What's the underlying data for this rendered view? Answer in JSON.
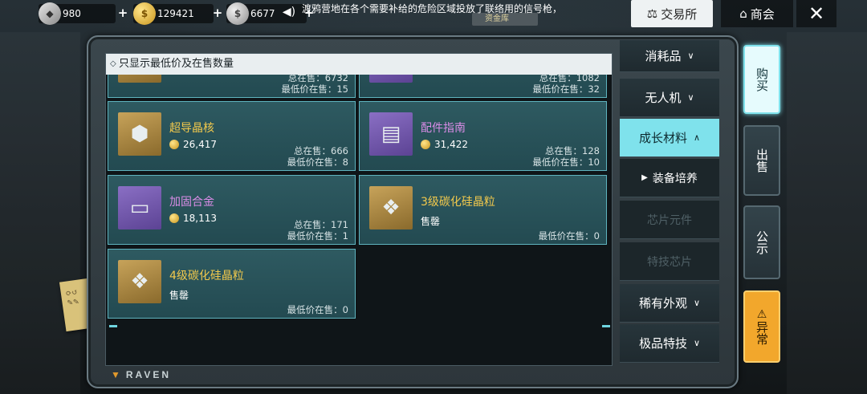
{
  "currencies": [
    {
      "name": "diamond",
      "icon": "diamond-icon",
      "value": "980"
    },
    {
      "name": "gold-coin",
      "icon": "gold-coin-icon",
      "value": "129421"
    },
    {
      "name": "silver-coin",
      "icon": "silver-coin-icon",
      "value": "6677"
    }
  ],
  "marquee": "渡鸦营地在各个需要补给的危险区域投放了联络用的信号枪，",
  "vault_chip": "资金库",
  "nav": {
    "exchange_label": "交易所",
    "guild_label": "商会"
  },
  "filter_label": "只显示最低价及在售数量",
  "partial_cards": [
    {
      "on_sale": "总在售：6732",
      "lowest_on_sale": "最低价在售：15"
    },
    {
      "on_sale": "总在售：1082",
      "lowest_on_sale": "最低价在售：32"
    }
  ],
  "items": [
    {
      "name": "超导晶核",
      "color": "gold",
      "icon": "crystal-core-icon",
      "price": "26,417",
      "on_sale": "总在售：666",
      "lowest_on_sale": "最低价在售：8"
    },
    {
      "name": "配件指南",
      "color": "purple",
      "icon": "guide-book-icon",
      "price": "31,422",
      "on_sale": "总在售：128",
      "lowest_on_sale": "最低价在售：10"
    },
    {
      "name": "加固合金",
      "color": "purple",
      "icon": "alloy-plate-icon",
      "price": "18,113",
      "on_sale": "总在售：171",
      "lowest_on_sale": "最低价在售：1"
    },
    {
      "name": "3级碳化硅晶粒",
      "color": "gold",
      "icon": "silicon-grain-icon",
      "sold_out": "售罄",
      "lowest_on_sale": "最低价在售：0"
    },
    {
      "name": "4级碳化硅晶粒",
      "color": "gold",
      "icon": "silicon-grain-icon",
      "sold_out": "售罄",
      "lowest_on_sale": "最低价在售：0"
    }
  ],
  "categories": [
    {
      "label": "消耗品",
      "state": "collapsed"
    },
    {
      "label": "无人机",
      "state": "collapsed"
    },
    {
      "label": "成长材料",
      "state": "expanded"
    },
    {
      "label": "装备培养",
      "state": "selected-sub"
    },
    {
      "label": "芯片元件",
      "state": "disabled-sub"
    },
    {
      "label": "特技芯片",
      "state": "disabled-sub"
    },
    {
      "label": "稀有外观",
      "state": "collapsed"
    },
    {
      "label": "极品特技",
      "state": "collapsed"
    }
  ],
  "side_tabs": {
    "buy": "购买",
    "sell": "出售",
    "public": "公示",
    "abnormal": "异常"
  },
  "brand": "RAVEN",
  "colors": {
    "accent": "#7fe2ec",
    "card_border": "#5fb4bf",
    "gold_name": "#f2c94c",
    "purple_name": "#d98ce6",
    "warn": "#f2a72c"
  }
}
